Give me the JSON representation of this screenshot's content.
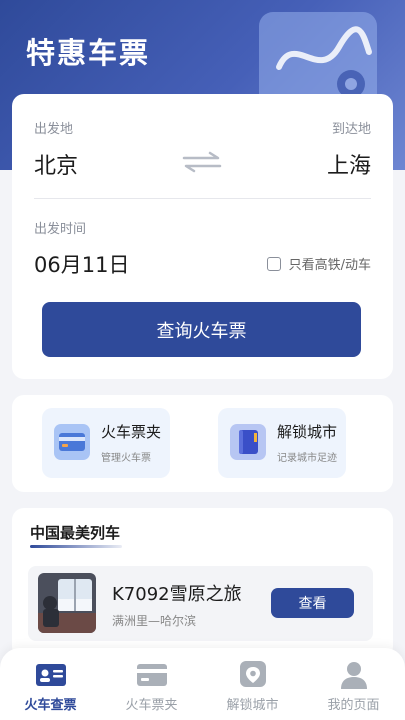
{
  "header": {
    "title": "特惠车票"
  },
  "search": {
    "from_label": "出发地",
    "to_label": "到达地",
    "from_city": "北京",
    "to_city": "上海",
    "date_label": "出发时间",
    "date_value": "06月11日",
    "high_speed_only_label": "只看高铁/动车",
    "high_speed_only_checked": false,
    "query_button": "查询火车票"
  },
  "quick_actions": [
    {
      "title": "火车票夹",
      "subtitle": "管理火车票",
      "icon": "ticket-wallet-icon"
    },
    {
      "title": "解锁城市",
      "subtitle": "记录城市足迹",
      "icon": "city-book-icon"
    }
  ],
  "featured": {
    "section_title": "中国最美列车",
    "items": [
      {
        "name": "K7092雪原之旅",
        "route": "满洲里—哈尔滨",
        "action": "查看",
        "image": "train-window-snow-photo"
      }
    ]
  },
  "tabbar": {
    "active_index": 0,
    "tabs": [
      {
        "label": "火车查票",
        "icon": "id-card-icon"
      },
      {
        "label": "火车票夹",
        "icon": "card-icon"
      },
      {
        "label": "解锁城市",
        "icon": "location-pin-icon"
      },
      {
        "label": "我的页面",
        "icon": "user-icon"
      }
    ]
  },
  "colors": {
    "primary": "#2f4a9a",
    "background": "#f3f4f8",
    "tile_bg": "#eef4fd",
    "inactive": "#9aa0a8"
  }
}
